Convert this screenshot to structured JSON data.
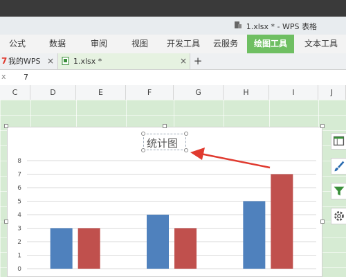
{
  "window": {
    "title": "1.xlsx * - WPS 表格"
  },
  "ribbon": {
    "tabs": [
      "公式",
      "数据",
      "审阅",
      "视图",
      "开发工具",
      "云服务",
      "绘图工具",
      "文本工具"
    ],
    "active_tab": "绘图工具",
    "accent_color": "#6fbf62"
  },
  "doc_tabs": {
    "tabs": [
      {
        "label": "我的WPS",
        "icon": "wps-logo-icon"
      },
      {
        "label": "1.xlsx *",
        "icon": "spreadsheet-file-icon"
      }
    ],
    "new_tab_label": "+",
    "close_label": "×"
  },
  "formula_bar": {
    "fx_label": "x",
    "value": "7"
  },
  "columns": [
    "C",
    "D",
    "E",
    "F",
    "G",
    "H",
    "I",
    "J"
  ],
  "chart_data": {
    "type": "bar",
    "title": "统计图",
    "categories": [
      "",
      "",
      ""
    ],
    "series": [
      {
        "color": "#4f81bd",
        "values": [
          3,
          4,
          5
        ]
      },
      {
        "color": "#c0504d",
        "values": [
          3,
          3,
          7
        ]
      }
    ],
    "ylim": [
      0,
      8
    ],
    "yticks": [
      0,
      1,
      2,
      3,
      4,
      5,
      6,
      7,
      8
    ],
    "grid": true
  },
  "annotation": {
    "arrow_color": "#e03a2f"
  },
  "side_tools": [
    "chart-elements-icon",
    "chart-style-icon",
    "chart-filter-icon",
    "settings-gear-icon"
  ]
}
